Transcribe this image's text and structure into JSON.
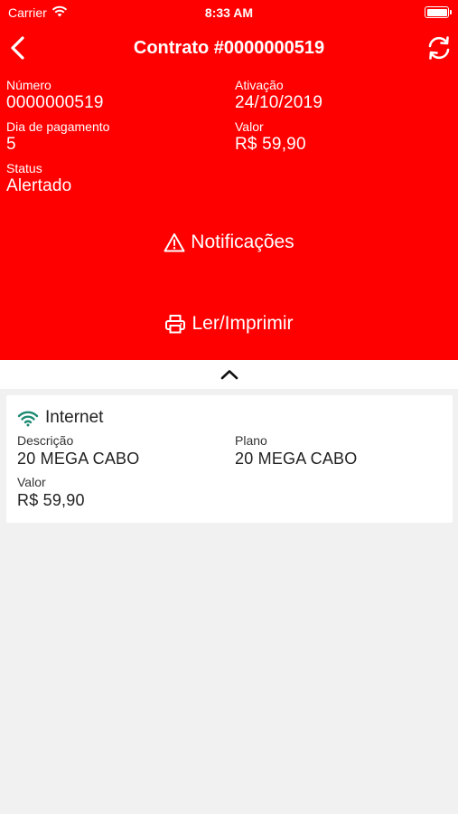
{
  "status_bar": {
    "carrier": "Carrier",
    "time": "8:33 AM"
  },
  "header": {
    "title": "Contrato #0000000519"
  },
  "contract": {
    "numero_label": "Número",
    "numero_value": "0000000519",
    "ativacao_label": "Ativação",
    "ativacao_value": "24/10/2019",
    "dia_label": "Dia de pagamento",
    "dia_value": "5",
    "valor_label": "Valor",
    "valor_value": "R$ 59,90",
    "status_label": "Status",
    "status_value": "Alertado"
  },
  "actions": {
    "notificacoes": "Notificações",
    "ler_imprimir": "Ler/Imprimir"
  },
  "service_card": {
    "title": "Internet",
    "descricao_label": "Descrição",
    "descricao_value": "20 MEGA CABO",
    "plano_label": "Plano",
    "plano_value": "20 MEGA CABO",
    "valor_label": "Valor",
    "valor_value": "R$ 59,90"
  },
  "colors": {
    "primary": "#ff0000",
    "wifi_icon": "#1e8a73",
    "background": "#f1f1f1"
  },
  "icons": [
    "wifi-icon",
    "battery-icon",
    "back-chevron-icon",
    "refresh-icon",
    "warning-icon",
    "printer-icon",
    "chevron-up-icon",
    "internet-wifi-icon"
  ]
}
